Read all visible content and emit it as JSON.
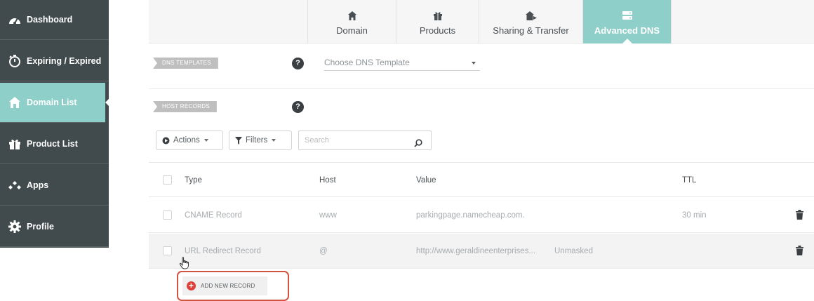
{
  "sidebar": {
    "items": [
      {
        "label": "Dashboard",
        "icon": "dashboard-gauge-icon"
      },
      {
        "label": "Expiring / Expired",
        "icon": "stopwatch-icon"
      },
      {
        "label": "Domain List",
        "icon": "home-icon"
      },
      {
        "label": "Product List",
        "icon": "gift-box-icon"
      },
      {
        "label": "Apps",
        "icon": "apps-diamonds-icon"
      },
      {
        "label": "Profile",
        "icon": "gear-icon"
      }
    ],
    "active": "Domain List"
  },
  "tabs": [
    {
      "label": "Domain",
      "icon": "home-icon"
    },
    {
      "label": "Products",
      "icon": "gift-box-icon"
    },
    {
      "label": "Sharing & Transfer",
      "icon": "share-house-icon"
    },
    {
      "label": "Advanced DNS",
      "icon": "server-icon"
    }
  ],
  "dns_templates": {
    "tag": "DNS TEMPLATES",
    "help": "?",
    "select_placeholder": "Choose DNS Template"
  },
  "host_records": {
    "tag": "HOST RECORDS",
    "help": "?"
  },
  "toolbar": {
    "actions_label": "Actions",
    "filters_label": "Filters",
    "search_placeholder": "Search"
  },
  "table": {
    "headers": {
      "type": "Type",
      "host": "Host",
      "value": "Value",
      "ttl": "TTL"
    },
    "rows": [
      {
        "type": "CNAME Record",
        "host": "www",
        "value": "parkingpage.namecheap.com.",
        "extra": "",
        "ttl": "30 min"
      },
      {
        "type": "URL Redirect Record",
        "host": "@",
        "value": "http://www.geraldineenterprises...",
        "extra": "Unmasked",
        "ttl": ""
      }
    ]
  },
  "add_record_label": "ADD NEW RECORD",
  "colors": {
    "sidebar_bg": "#414a4c",
    "accent_teal": "#8ecfca",
    "highlight_red": "#d1543f",
    "add_icon_red": "#e0403a"
  }
}
